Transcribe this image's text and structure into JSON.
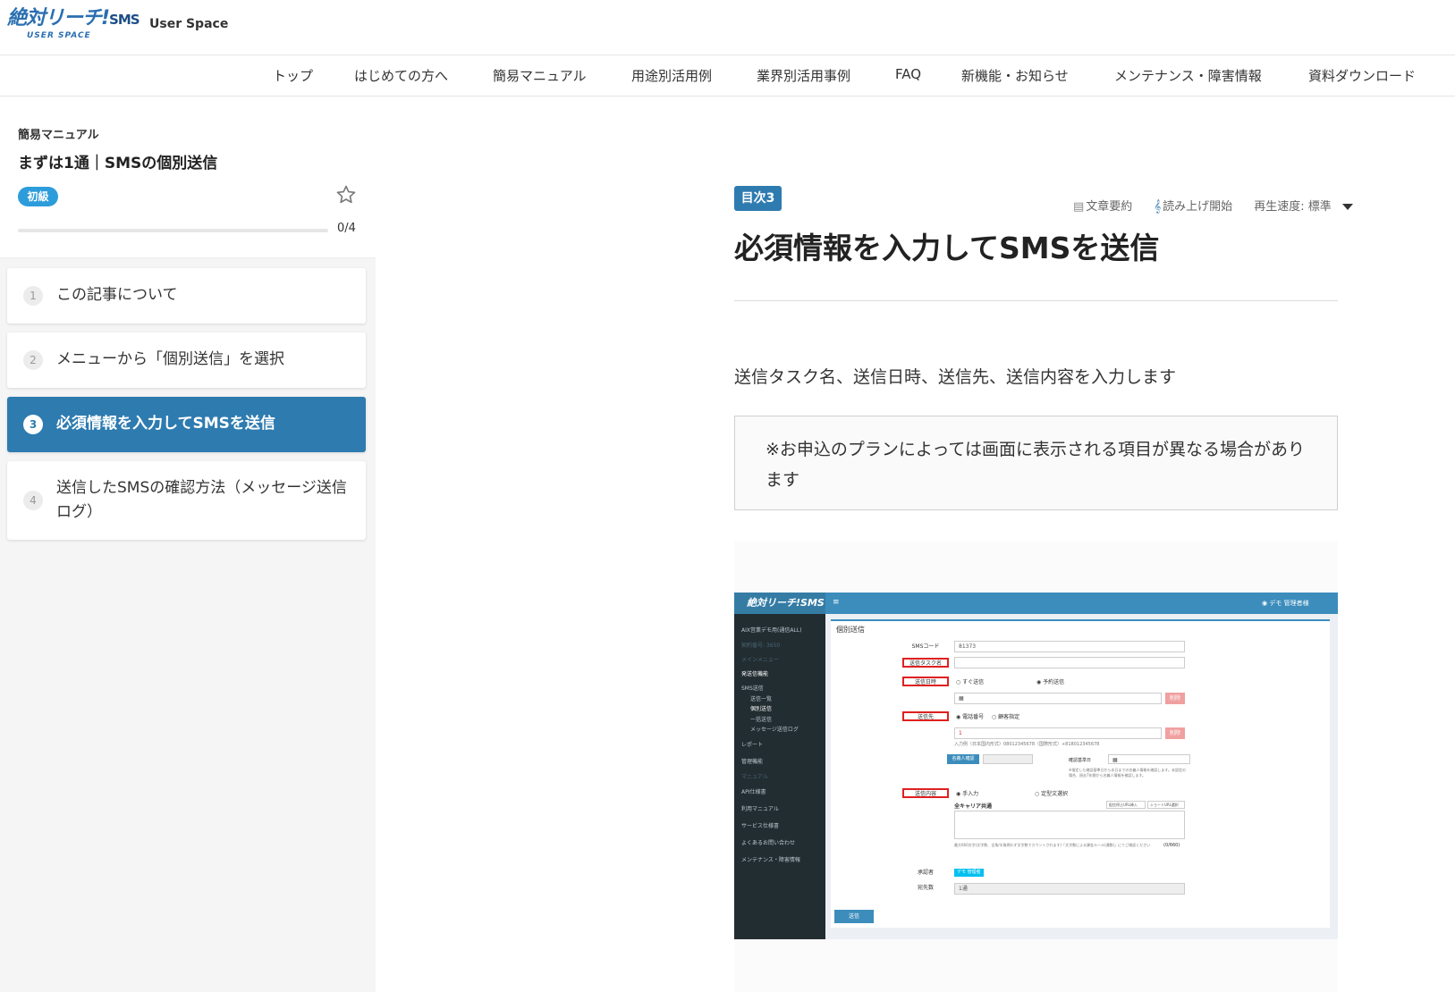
{
  "header": {
    "logo_text": "絶対リーチ!",
    "logo_sms": "SMS",
    "logo_sub": "USER SPACE",
    "user_space": "User Space"
  },
  "nav": {
    "items": [
      "トップ",
      "はじめての方へ",
      "簡易マニュアル",
      "用途別活用例",
      "業界別活用事例",
      "FAQ",
      "新機能・お知らせ",
      "メンテナンス・障害情報",
      "資料ダウンロード"
    ]
  },
  "sidebar": {
    "category": "簡易マニュアル",
    "title": "まずは1通｜SMSの個別送信",
    "level": "初級",
    "progress_text": "0/4",
    "progress_fraction": 0,
    "steps": [
      {
        "num": "1",
        "label": "この記事について"
      },
      {
        "num": "2",
        "label": "メニューから「個別送信」を選択"
      },
      {
        "num": "3",
        "label": "必須情報を入力してSMSを送信"
      },
      {
        "num": "4",
        "label": "送信したSMSの確認方法（メッセージ送信ログ）"
      }
    ],
    "active_step": 3
  },
  "main": {
    "toc_badge": "目次3",
    "tools": {
      "summary": "文章要約",
      "read_aloud": "読み上げ開始",
      "speed": "再生速度: 標準"
    },
    "title": "必須情報を入力してSMSを送信",
    "lead": "送信タスク名、送信日時、送信先、送信内容を入力します",
    "note": "※お申込のプランによっては画面に表示される項目が異なる場合があります"
  },
  "screenshot": {
    "logo": "絶対リーチ!SMS",
    "user": "デモ 管理者様",
    "sidebar": {
      "account": "AIX営業デモ用(通信ALL)",
      "contract": "契約番号: 3650",
      "main_menu": "メインメニュー",
      "send_func": "発送信機能",
      "sms_send": "SMS送信",
      "sub_items": [
        "送信一覧",
        "個別送信",
        "一括送信",
        "メッセージ送信ログ"
      ],
      "report": "レポート",
      "admin": "管理機能",
      "manual_head": "マニュアル",
      "links": [
        "API仕様書",
        "利用マニュアル",
        "サービス仕様書",
        "よくあるお問い合わせ",
        "メンテナンス・障害情報"
      ]
    },
    "panel_title": "個別送信",
    "sms_code_label": "SMSコード",
    "sms_code_value": "81373",
    "task_name_label": "送信タスク名",
    "datetime_label": "送信日時",
    "send_now": "すぐ送信",
    "reserve": "予約送信",
    "delete": "削除",
    "dest_label": "送信先",
    "phone": "電話番号",
    "customer": "顧客指定",
    "row_num": "1",
    "input_example": "入力例（日本国内形式）08012345678（国際形式）+818012345678",
    "name_confirm": "名義人確認",
    "confirm_date": "確認基準日",
    "confirm_note": "※指定した確認基準日から本日までの名義人情報を確認します。未設定の場合、過去7年間から名義人情報を確認します。",
    "content_label": "送信内容",
    "manual_input": "手入力",
    "template": "定型文選択",
    "all_carrier": "全キャリア共通",
    "insert_stop": "配信停止URL挿入",
    "short_url": "ショートURL選択",
    "char_note": "最大660文字(文字数、全角/半角問わず文字数でカウントされます)「文字数による課金ルール(通数)」にてご確認ください",
    "char_count": "(0/660)",
    "approver_label": "承認者",
    "approver_value": "デモ 管理者",
    "count_label": "宛先数",
    "count_value": "1通",
    "send_button": "送信"
  }
}
